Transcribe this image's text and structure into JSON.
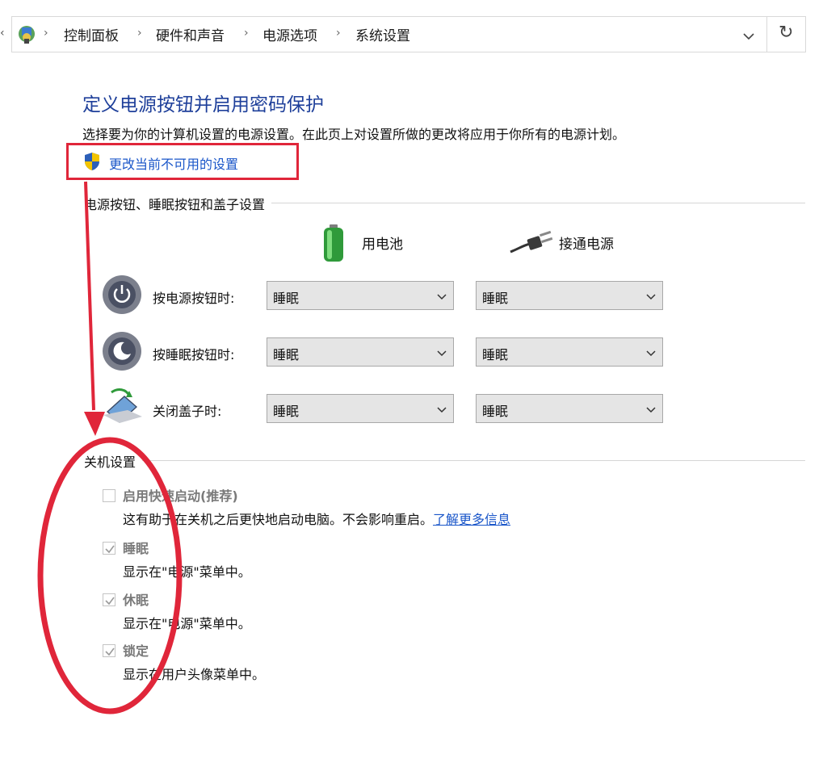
{
  "address_bar": {
    "breadcrumbs": [
      "控制面板",
      "硬件和声音",
      "电源选项",
      "系统设置"
    ],
    "separator": "›",
    "dropdown_glyph": "⌄",
    "refresh_glyph": "↻",
    "back_glyph": "‹"
  },
  "page": {
    "title": "定义电源按钮并启用密码保护",
    "description": "选择要为你的计算机设置的电源设置。在此页上对设置所做的更改将应用于你所有的电源计划。",
    "change_link": "更改当前不可用的设置"
  },
  "power_buttons": {
    "group_title": "电源按钮、睡眠按钮和盖子设置",
    "columns": [
      "用电池",
      "接通电源"
    ],
    "rows": [
      {
        "label": "按电源按钮时:",
        "battery": "睡眠",
        "plugged": "睡眠",
        "icon": "power-button-icon"
      },
      {
        "label": "按睡眠按钮时:",
        "battery": "睡眠",
        "plugged": "睡眠",
        "icon": "sleep-button-icon"
      },
      {
        "label": "关闭盖子时:",
        "battery": "睡眠",
        "plugged": "睡眠",
        "icon": "laptop-lid-icon"
      }
    ]
  },
  "shutdown": {
    "group_title": "关机设置",
    "options": [
      {
        "label": "启用快速启动(推荐)",
        "desc": "这有助于在关机之后更快地启动电脑。不会影响重启。",
        "link": "了解更多信息",
        "checked": false
      },
      {
        "label": "睡眠",
        "desc": "显示在\"电源\"菜单中。",
        "checked": true
      },
      {
        "label": "休眠",
        "desc": "显示在\"电源\"菜单中。",
        "checked": true
      },
      {
        "label": "锁定",
        "desc": "显示在用户头像菜单中。",
        "checked": true
      }
    ]
  },
  "colors": {
    "title": "#1e3f9a",
    "link": "#1a56c9",
    "annotation_red": "#e0263a",
    "battery_green": "#3cb043"
  }
}
